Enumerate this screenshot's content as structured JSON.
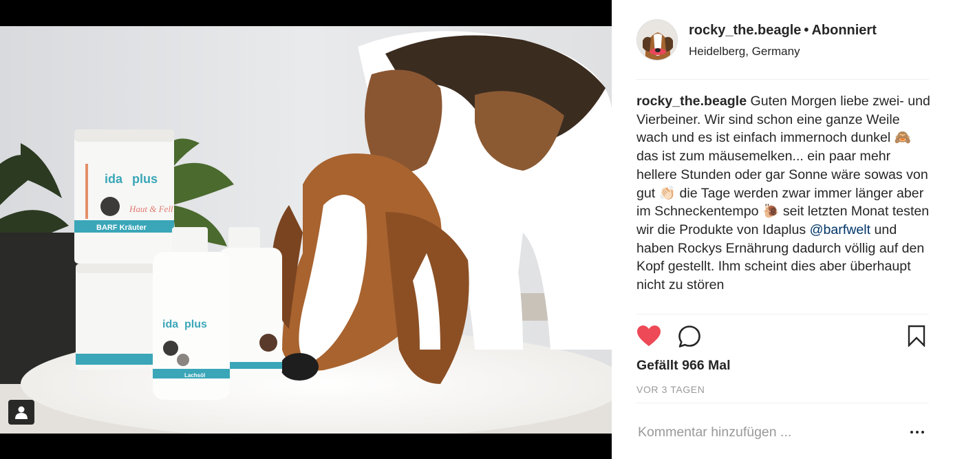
{
  "post": {
    "username": "rocky_the.beagle",
    "separator": "•",
    "follow_status": "Abonniert",
    "location": "Heidelberg, Germany",
    "caption": {
      "author": "rocky_the.beagle",
      "text_1": "Guten Morgen liebe zwei- und Vierbeiner. Wir sind schon eine ganze Weile wach und es ist einfach immernoch dunkel ",
      "emoji_1": "🙈",
      "text_2": " das ist zum mäusemelken... ein paar mehr hellere Stunden oder gar Sonne wäre sowas von gut ",
      "emoji_2": "👏🏻",
      "text_3": " die Tage werden zwar immer länger aber im Schneckentempo ",
      "emoji_3": "🐌",
      "text_4": " seit letzten Monat testen wir die Produkte von Idaplus ",
      "mention": "@barfwelt",
      "text_5": " und haben Rockys Ernährung dadurch völlig auf den Kopf gestellt. Ihm scheint dies aber überhaupt nicht zu stören"
    },
    "likes": "Gefällt 966 Mal",
    "time_ago": "VOR 3 TAGEN",
    "comment_placeholder": "Kommentar hinzufügen ...",
    "liked": true
  },
  "photo": {
    "product_brand": "ida",
    "product_brand_2": "plus",
    "jar_top_label": "Haut & Fell",
    "jar_top_band": "BARF Kräuter",
    "bottle_label": "Lachsöl"
  },
  "icons": {
    "like": "heart-icon",
    "comment": "comment-bubble-icon",
    "save": "bookmark-icon",
    "more": "more-options-icon",
    "tag": "user-tag-icon"
  },
  "colors": {
    "heart": "#ed4956",
    "mention": "#003569",
    "muted": "#999999",
    "brand_teal": "#3aa6b8"
  }
}
